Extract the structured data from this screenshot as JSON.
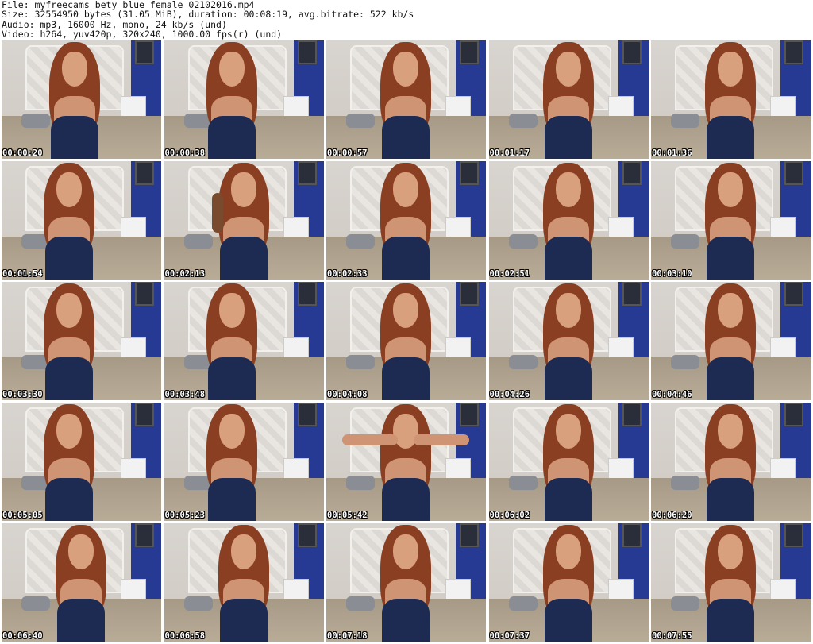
{
  "header": {
    "file": "File: myfreecams_bety_blue_female_02102016.mp4",
    "size": "Size: 32554950 bytes (31.05 MiB), duration: 00:08:19, avg.bitrate: 522 kb/s",
    "audio": "Audio: mp3, 16000 Hz, mono, 24 kb/s (und)",
    "video": "Video: h264, yuv420p, 320x240, 1000.00 fps(r) (und)"
  },
  "thumbnails": [
    {
      "time": "00:00:20",
      "pose": "center-left"
    },
    {
      "time": "00:00:38",
      "pose": "lean-left"
    },
    {
      "time": "00:00:57",
      "pose": "center"
    },
    {
      "time": "00:01:17",
      "pose": "center"
    },
    {
      "time": "00:01:36",
      "pose": "center"
    },
    {
      "time": "00:01:54",
      "pose": "left"
    },
    {
      "time": "00:02:13",
      "pose": "drinking"
    },
    {
      "time": "00:02:33",
      "pose": "center"
    },
    {
      "time": "00:02:51",
      "pose": "center"
    },
    {
      "time": "00:03:10",
      "pose": "center"
    },
    {
      "time": "00:03:30",
      "pose": "lean-left"
    },
    {
      "time": "00:03:48",
      "pose": "lean-left"
    },
    {
      "time": "00:04:08",
      "pose": "center"
    },
    {
      "time": "00:04:26",
      "pose": "center"
    },
    {
      "time": "00:04:46",
      "pose": "center"
    },
    {
      "time": "00:05:05",
      "pose": "left"
    },
    {
      "time": "00:05:23",
      "pose": "left"
    },
    {
      "time": "00:05:42",
      "pose": "arms-up"
    },
    {
      "time": "00:06:02",
      "pose": "center"
    },
    {
      "time": "00:06:20",
      "pose": "center"
    },
    {
      "time": "00:06:40",
      "pose": "center"
    },
    {
      "time": "00:06:58",
      "pose": "center"
    },
    {
      "time": "00:07:18",
      "pose": "center"
    },
    {
      "time": "00:07:37",
      "pose": "center"
    },
    {
      "time": "00:07:55",
      "pose": "center"
    }
  ]
}
